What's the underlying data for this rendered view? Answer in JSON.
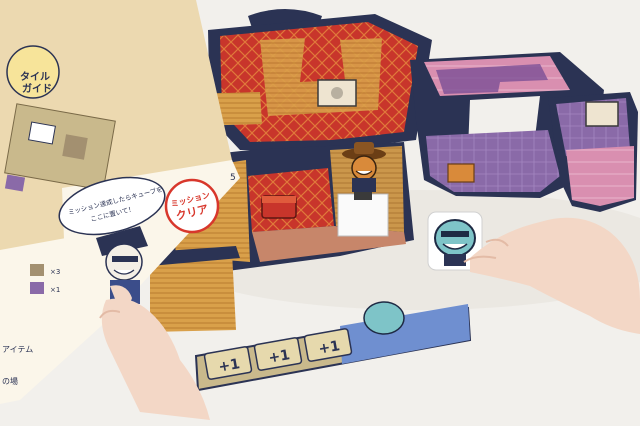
{
  "booklet": {
    "tile_guide_line1": "タイル",
    "tile_guide_line2": "ガイド",
    "mission_line1": "ミッション",
    "mission_line2": "クリア",
    "speech_line1": "ミッション達成したらキューブを",
    "speech_line2": "ここに置いて！",
    "page_number": "5",
    "row_x3": "×3",
    "row_x1": "×1",
    "label_item": "アイテム",
    "label_no": "の場"
  },
  "track": {
    "cells": [
      "+1",
      "+1",
      "+1"
    ]
  },
  "colors": {
    "table": "#f2f0ec",
    "board_red": "#c8352b",
    "board_gold": "#d9a04a",
    "tile_purple": "#8a6aa8",
    "tile_pink": "#d98fb0",
    "frame_navy": "#2b3354",
    "track_tan": "#d8c79a",
    "track_blue": "#6f8fd0",
    "skin": "#f3d7c6",
    "badge_red": "#d8372c"
  }
}
